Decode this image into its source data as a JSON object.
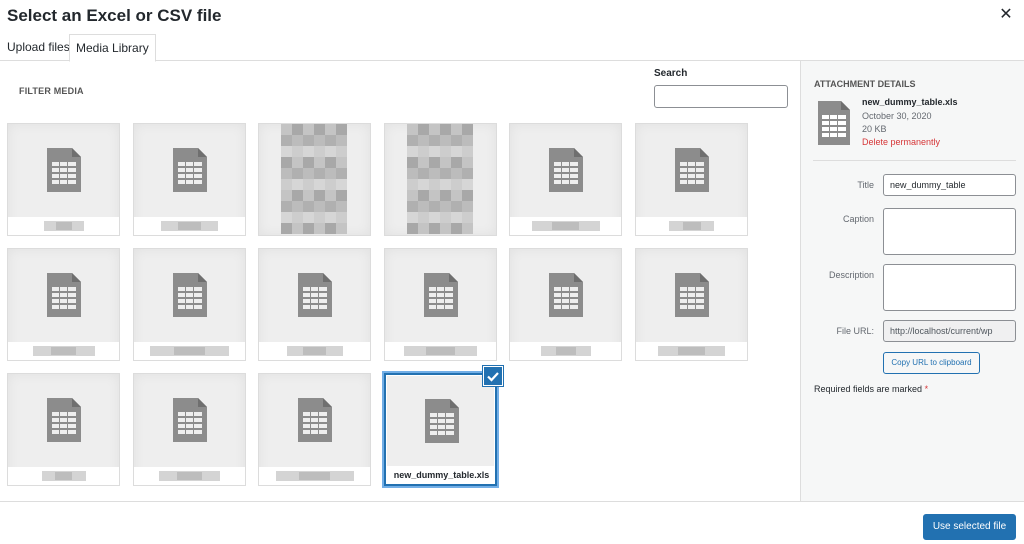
{
  "modal": {
    "title": "Select an Excel or CSV file",
    "close_icon": "close-icon"
  },
  "tabs": [
    {
      "label": "Upload files",
      "active": false
    },
    {
      "label": "Media Library",
      "active": true
    }
  ],
  "toolbar": {
    "filter_label": "FILTER MEDIA",
    "search_label": "Search",
    "search_value": ""
  },
  "media_items": [
    {
      "type": "spreadsheet",
      "caption": ""
    },
    {
      "type": "spreadsheet",
      "caption": ""
    },
    {
      "type": "image",
      "caption": ""
    },
    {
      "type": "image",
      "caption": ""
    },
    {
      "type": "spreadsheet",
      "caption": ""
    },
    {
      "type": "spreadsheet",
      "caption": ""
    },
    {
      "type": "spreadsheet",
      "caption": ""
    },
    {
      "type": "spreadsheet",
      "caption": ""
    },
    {
      "type": "spreadsheet",
      "caption": ""
    },
    {
      "type": "spreadsheet",
      "caption": ""
    },
    {
      "type": "spreadsheet",
      "caption": ""
    },
    {
      "type": "spreadsheet",
      "caption": ""
    },
    {
      "type": "spreadsheet",
      "caption": ""
    },
    {
      "type": "spreadsheet",
      "caption": ""
    },
    {
      "type": "spreadsheet",
      "caption": ""
    },
    {
      "type": "spreadsheet",
      "caption": "new_dummy_table.xls",
      "selected": true
    }
  ],
  "attachment": {
    "heading": "ATTACHMENT DETAILS",
    "filename": "new_dummy_table.xls",
    "date": "October 30, 2020",
    "size": "20 KB",
    "delete_label": "Delete permanently",
    "fields": {
      "title_label": "Title",
      "title_value": "new_dummy_table",
      "caption_label": "Caption",
      "caption_value": "",
      "description_label": "Description",
      "description_value": "",
      "url_label": "File URL:",
      "url_value": "http://localhost/current/wp"
    },
    "copy_label": "Copy URL to clipboard",
    "required_text": "Required fields are marked",
    "required_star": "*"
  },
  "footer": {
    "primary_label": "Use selected file"
  },
  "colors": {
    "accent": "#2271b1",
    "danger": "#d63638",
    "tile_bg": "#eeeeee",
    "doc_icon": "#8c8c8c"
  }
}
